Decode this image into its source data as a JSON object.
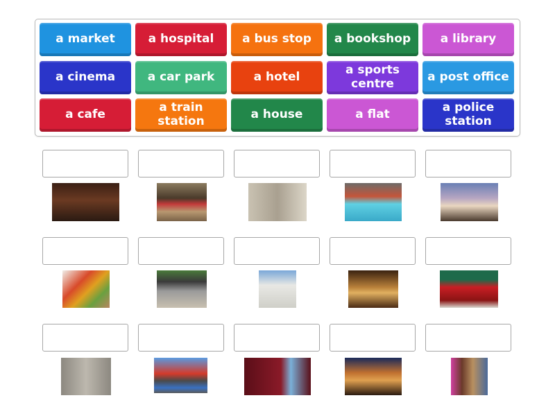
{
  "tiles": [
    {
      "label": "a market",
      "color": "#1f93e0"
    },
    {
      "label": "a hospital",
      "color": "#d61d36"
    },
    {
      "label": "a bus stop",
      "color": "#f5720f"
    },
    {
      "label": "a bookshop",
      "color": "#22874a"
    },
    {
      "label": "a library",
      "color": "#cb57d4"
    },
    {
      "label": "a cinema",
      "color": "#2a35c9"
    },
    {
      "label": "a car park",
      "color": "#40b77f"
    },
    {
      "label": "a hotel",
      "color": "#e8420f"
    },
    {
      "label": "a sports centre",
      "color": "#7d39dc"
    },
    {
      "label": "a post office",
      "color": "#2a99e2"
    },
    {
      "label": "a cafe",
      "color": "#d61d36"
    },
    {
      "label": "a train station",
      "color": "#f5770f"
    },
    {
      "label": "a house",
      "color": "#22874a"
    },
    {
      "label": "a flat",
      "color": "#cb57d4"
    },
    {
      "label": "a police station",
      "color": "#2a35c9"
    }
  ],
  "targets": [
    {
      "answer": "",
      "image": "cafe-photo"
    },
    {
      "answer": "",
      "image": "train-station-photo"
    },
    {
      "answer": "",
      "image": "police-station-photo"
    },
    {
      "answer": "",
      "image": "sports-centre-photo"
    },
    {
      "answer": "",
      "image": "house-photo"
    },
    {
      "answer": "",
      "image": "market-photo"
    },
    {
      "answer": "",
      "image": "bus-stop-photo"
    },
    {
      "answer": "",
      "image": "hospital-photo"
    },
    {
      "answer": "",
      "image": "library-photo"
    },
    {
      "answer": "",
      "image": "post-office-photo"
    },
    {
      "answer": "",
      "image": "flat-photo"
    },
    {
      "answer": "",
      "image": "car-park-photo"
    },
    {
      "answer": "",
      "image": "cinema-photo"
    },
    {
      "answer": "",
      "image": "hotel-photo"
    },
    {
      "answer": "",
      "image": "bookshop-photo"
    }
  ]
}
